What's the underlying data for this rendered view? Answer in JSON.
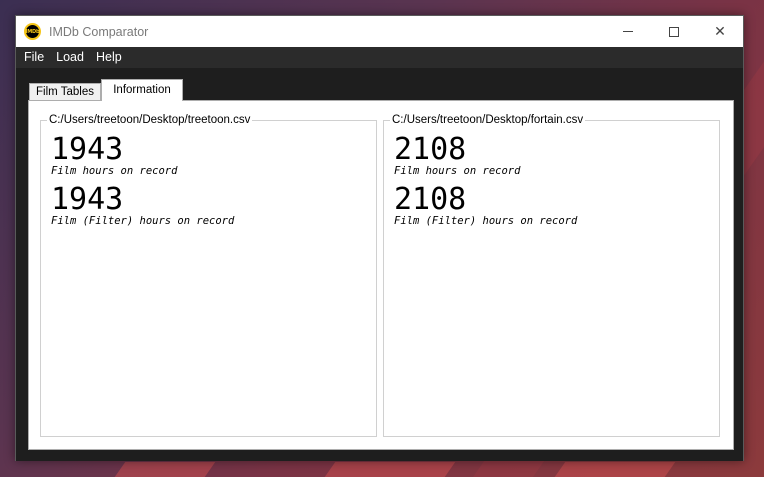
{
  "window": {
    "title": "IMDb Comparator",
    "icon_label": "IMDb",
    "accent_color": "#f5c518"
  },
  "title_buttons": {
    "minimize_icon": "minimize-icon",
    "maximize_icon": "maximize-icon",
    "close_icon": "close-icon",
    "close_glyph": "✕"
  },
  "menu": {
    "items": [
      {
        "label": "File"
      },
      {
        "label": "Load"
      },
      {
        "label": "Help"
      }
    ]
  },
  "tabs": [
    {
      "label": "Film Tables",
      "selected": false
    },
    {
      "label": "Information",
      "selected": true
    }
  ],
  "panels": [
    {
      "path": "C:/Users/treetoon/Desktop/treetoon.csv",
      "film_hours": "1943",
      "film_hours_label": "Film hours on record",
      "filter_hours": "1943",
      "filter_hours_label": "Film (Filter) hours on record"
    },
    {
      "path": "C:/Users/treetoon/Desktop/fortain.csv",
      "film_hours": "2108",
      "film_hours_label": "Film hours on record",
      "filter_hours": "2108",
      "filter_hours_label": "Film (Filter) hours on record"
    }
  ]
}
